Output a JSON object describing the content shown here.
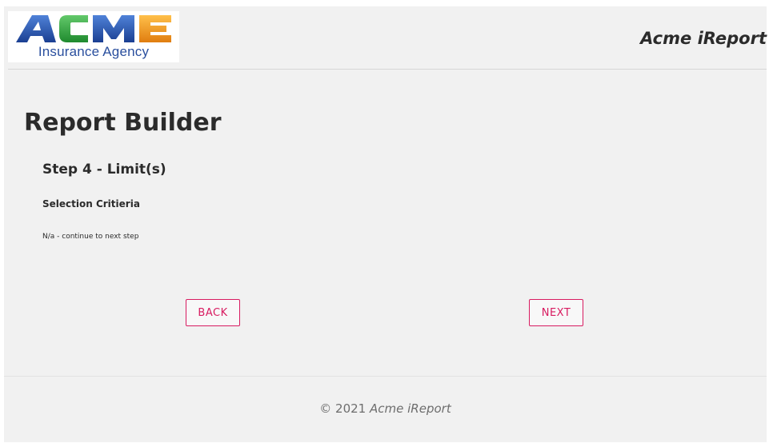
{
  "header": {
    "logo_word": "ACME",
    "logo_subtitle": "Insurance Agency",
    "logo_colors": [
      "#1e4fa8",
      "#2aa33b",
      "#1e4fa8",
      "#f2a01e"
    ],
    "app_title": "Acme iReport"
  },
  "main": {
    "page_title": "Report Builder",
    "step_title": "Step 4 - Limit(s)",
    "section_label": "Selection Critieria",
    "note": "N/a - continue to next step",
    "back_label": "BACK",
    "next_label": "NEXT",
    "accent_color": "#d81b60"
  },
  "footer": {
    "copyright": "© 2021",
    "app_name": "Acme iReport"
  }
}
